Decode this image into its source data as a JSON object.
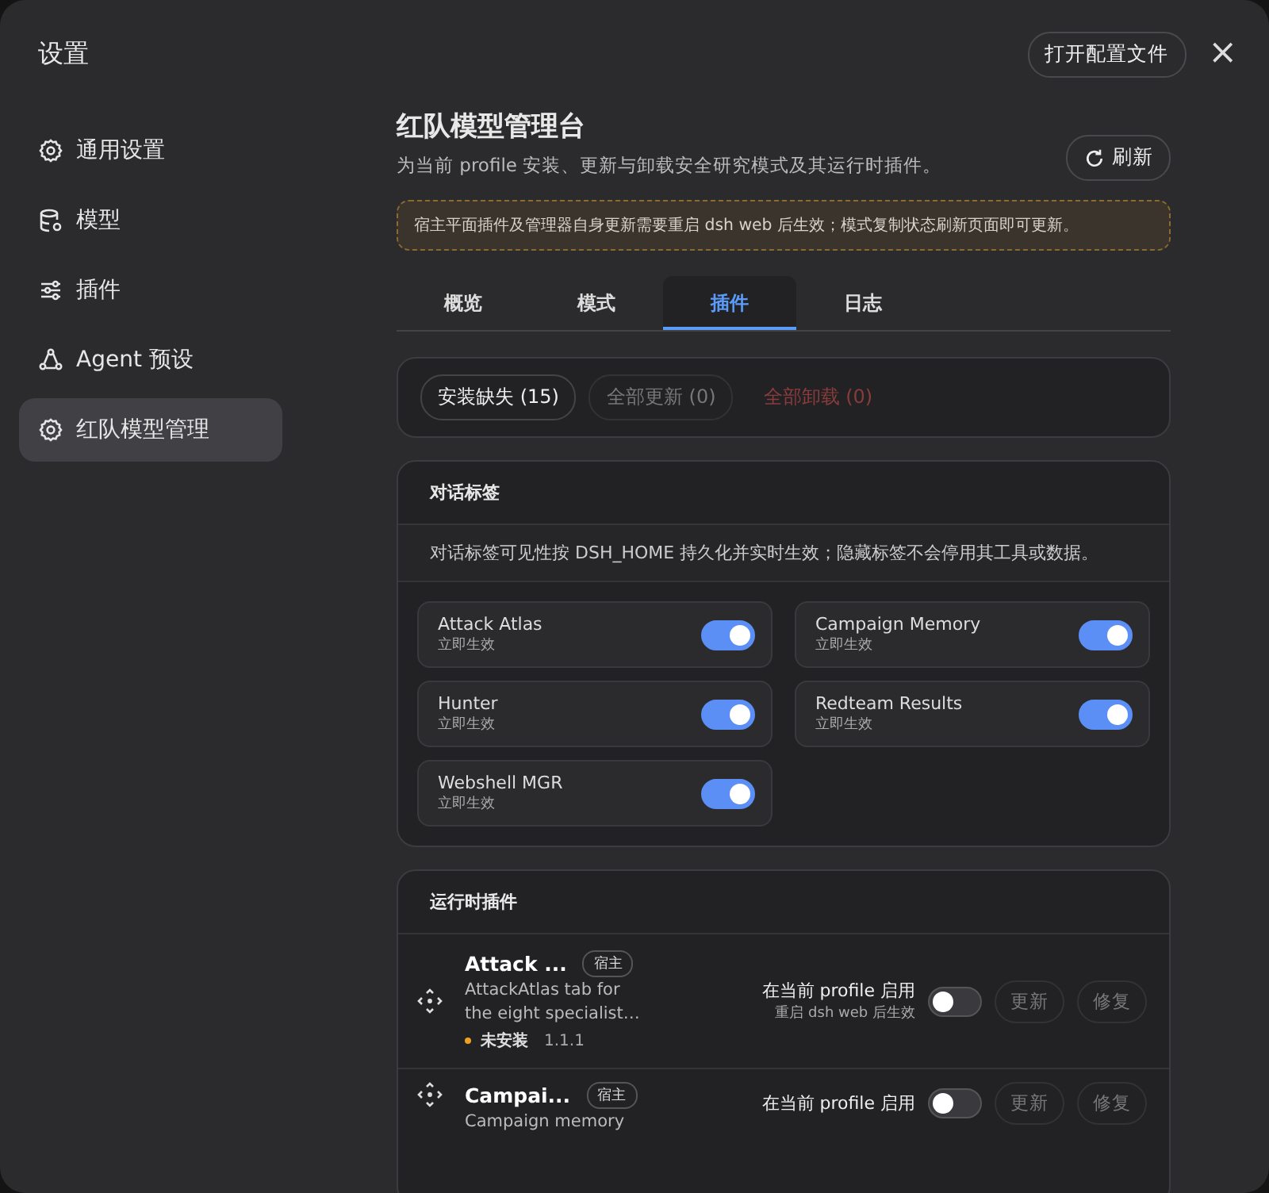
{
  "window": {
    "title": "设置",
    "open_config_button": "打开配置文件",
    "close_glyph": "×"
  },
  "sidebar": {
    "items": [
      {
        "label": "通用设置",
        "selected": false
      },
      {
        "label": "模型",
        "selected": false
      },
      {
        "label": "插件",
        "selected": false
      },
      {
        "label": "Agent 预设",
        "selected": false
      },
      {
        "label": "红队模型管理",
        "selected": true
      }
    ]
  },
  "header": {
    "title": "红队模型管理台",
    "subtitle": "为当前 profile 安装、更新与卸载安全研究模式及其运行时插件。",
    "refresh_button": "刷新"
  },
  "notice": "宿主平面插件及管理器自身更新需要重启 dsh web 后生效；模式复制状态刷新页面即可更新。",
  "tabs": [
    {
      "label": "概览",
      "selected": false
    },
    {
      "label": "模式",
      "selected": false
    },
    {
      "label": "插件",
      "selected": true
    },
    {
      "label": "日志",
      "selected": false
    }
  ],
  "bulk_actions": [
    {
      "label": "安装缺失 (15)",
      "kind": "normal",
      "disabled": false
    },
    {
      "label": "全部更新 (0)",
      "kind": "normal",
      "disabled": true
    },
    {
      "label": "全部卸载 (0)",
      "kind": "danger",
      "disabled": true
    }
  ],
  "chat_tabs": {
    "title": "对话标签",
    "description": "对话标签可见性按 DSH_HOME 持久化并实时生效；隐藏标签不会停用其工具或数据。",
    "items": [
      {
        "name": "Attack Atlas",
        "hint": "立即生效",
        "on": true
      },
      {
        "name": "Campaign Memory",
        "hint": "立即生效",
        "on": true
      },
      {
        "name": "Hunter",
        "hint": "立即生效",
        "on": true
      },
      {
        "name": "Redteam Results",
        "hint": "立即生效",
        "on": true
      },
      {
        "name": "Webshell MGR",
        "hint": "立即生效",
        "on": true
      }
    ]
  },
  "runtime_plugins": {
    "title": "运行时插件",
    "items": [
      {
        "name": "Attack ...",
        "badge": "宿主",
        "description": "AttackAtlas tab for the eight specialist…",
        "status": "未安装",
        "version": "1.1.1",
        "enable_label": "在当前 profile 启用",
        "enable_hint": "重启 dsh web 后生效",
        "on": false,
        "buttons": [
          {
            "label": "更新",
            "disabled": true
          },
          {
            "label": "修复",
            "disabled": true
          }
        ]
      },
      {
        "name": "Campai...",
        "badge": "宿主",
        "description": "Campaign memory",
        "enable_label": "在当前 profile 启用",
        "on": false,
        "buttons": [
          {
            "label": "更新",
            "disabled": true
          },
          {
            "label": "修复",
            "disabled": true
          }
        ]
      }
    ]
  }
}
